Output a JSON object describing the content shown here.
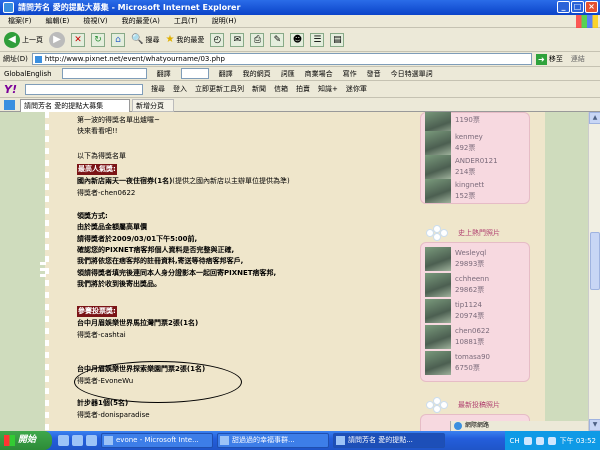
{
  "window": {
    "title": "請問芳名 愛的提點大募集 - Microsoft Internet Explorer",
    "controls": [
      "_",
      "□",
      "×"
    ]
  },
  "menu": [
    "檔案(F)",
    "編輯(E)",
    "檢視(V)",
    "我的最愛(A)",
    "工具(T)",
    "說明(H)"
  ],
  "toolbar": {
    "back": "上一頁",
    "search": "搜尋",
    "favorites": "我的最愛"
  },
  "address": {
    "label": "網址(D)",
    "url": "http://www.pixnet.net/event/whatyourname/03.php",
    "go": "移至",
    "links": "連結"
  },
  "toolbar3": {
    "globalenglish": "GlobalEnglish",
    "translate": "翻譯",
    "pinyin": "翻譯",
    "my_page": "我的網頁",
    "dictionary": "詞匯",
    "business": "商業場合",
    "writing": "寫作",
    "pronounce": "發音",
    "word_of_day": "今日特選單詞"
  },
  "toolbar4": {
    "search": "搜尋",
    "login": "登入",
    "update": "立即更新工具列",
    "news": "新聞",
    "mail": "信箱",
    "auction": "拍賣",
    "knowledge": "知識+",
    "mini": "迷你軍"
  },
  "tabs": {
    "active": "請問芳名 愛的提點大募集",
    "new_tab": "新增分頁"
  },
  "article": {
    "intro1": "第一波的得獎名單出爐囉~",
    "intro2": "快來看看吧!!",
    "list_heading": "以下為得獎名單",
    "popular_tag": "最高人氣獎:",
    "popular_prize": "國內新店兩天一夜住宿券(1名)",
    "popular_note": "(提供之國內新店以主辦單位提供為準)",
    "popular_winner": "得獎者-chen0622",
    "method_heading": "領獎方式:",
    "method1": "由於獎品金額屬高單價",
    "method2": "請得獎者於2009/03/01下午5:00前,",
    "method3": "確認您的PIXNET痞客邦個人資料是否完整與正確,",
    "method4": "我們將依您在痞客邦的註冊資料,寄送等待痞客邦客戶,",
    "method5": "領請得獎者填完後連同本人身分證影本一起回寄PIXNET痞客邦,",
    "method6": "我們將於收到後寄出獎品。",
    "vote_tag": "參賽投票獎:",
    "vote_prize1": "台中月眉娛樂世界馬拉灣門票2張(1名)",
    "vote_winner1": "得獎者-cashtai",
    "vote_prize2": "台中月眉娛樂世界探索樂園門票2張(1名)",
    "vote_winner2": "得獎者-EvoneWu",
    "vote_prize3": "計步器1個(5名)",
    "vote_winner3": "得獎者-donisparadise"
  },
  "sidebar": {
    "top_entries": [
      {
        "name": "",
        "votes": "1190票"
      },
      {
        "name": "kenmey",
        "votes": "492票"
      },
      {
        "name": "ANDER0121",
        "votes": "214票"
      },
      {
        "name": "kingnett",
        "votes": "152票"
      }
    ],
    "popular_heading": "史上熱門照片",
    "popular_entries": [
      {
        "name": "Wesleyql",
        "votes": "29893票"
      },
      {
        "name": "cchheenn",
        "votes": "29862票"
      },
      {
        "name": "tip1124",
        "votes": "20974票"
      },
      {
        "name": "chen0622",
        "votes": "10881票"
      },
      {
        "name": "tomasa90",
        "votes": "6750票"
      }
    ],
    "latest_heading": "最新投稿照片"
  },
  "statusbar": {
    "zone": "網際網路"
  },
  "taskbar": {
    "start": "開始",
    "tasks": [
      "evone - Microsoft Inte...",
      "甜過過的幸福事群...",
      "請問芳名 愛的提點..."
    ],
    "lang": "CH",
    "clock": "下午 03:52"
  }
}
